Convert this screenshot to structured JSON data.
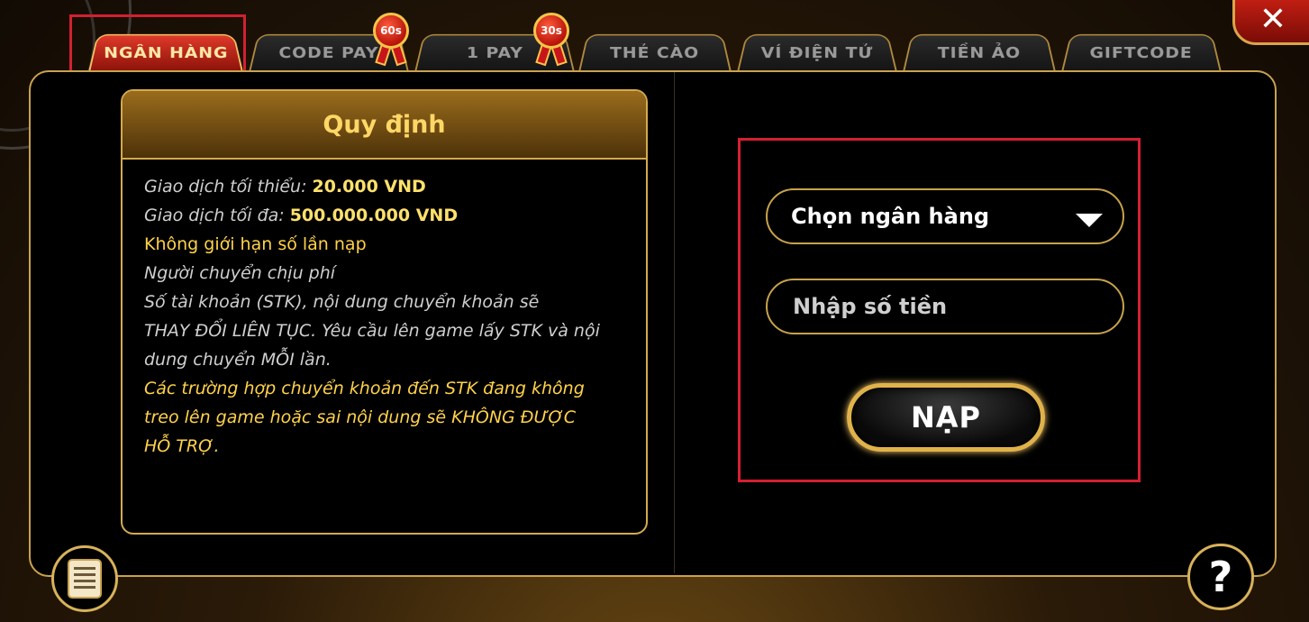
{
  "tabs": [
    {
      "label": "NGÂN HÀNG",
      "active": true
    },
    {
      "label": "CODE PAY",
      "badge": "60s"
    },
    {
      "label": "1 PAY",
      "badge": "30s"
    },
    {
      "label": "THẺ CÀO"
    },
    {
      "label": "VÍ ĐIỆN TỬ"
    },
    {
      "label": "TIỀN ẢO"
    },
    {
      "label": "GIFTCODE"
    }
  ],
  "rules": {
    "title": "Quy định",
    "min_label": "Giao dịch tối thiểu:",
    "min_value": "20.000 VND",
    "max_label": "Giao dịch tối đa:",
    "max_value": "500.000.000 VND",
    "unlimited": "Không giới hạn số  lần nạp",
    "fee": "Người chuyển chịu phí",
    "note_lines": [
      "Số tài khoản (STK), nội dung chuyển khoản sẽ",
      "THAY ĐỔI LIÊN TỤC. Yêu cầu lên game lấy STK và nội",
      "dung chuyển MỖI lần."
    ],
    "warning_lines": [
      "Các trường hợp chuyển khoản đến STK đang không",
      "treo lên game hoặc sai nội dung sẽ KHÔNG ĐƯỢC",
      "HỖ TRỢ."
    ]
  },
  "form": {
    "bank_select": "Chọn ngân hàng",
    "amount_placeholder": "Nhập số tiền",
    "submit_label": "NẠP"
  },
  "icons": {
    "close": "close-icon",
    "list": "list-icon",
    "help": "help-icon"
  },
  "colors": {
    "accent_gold": "#d4aa4e",
    "active_tab": "#e03a2a",
    "highlight": "#d42030"
  }
}
